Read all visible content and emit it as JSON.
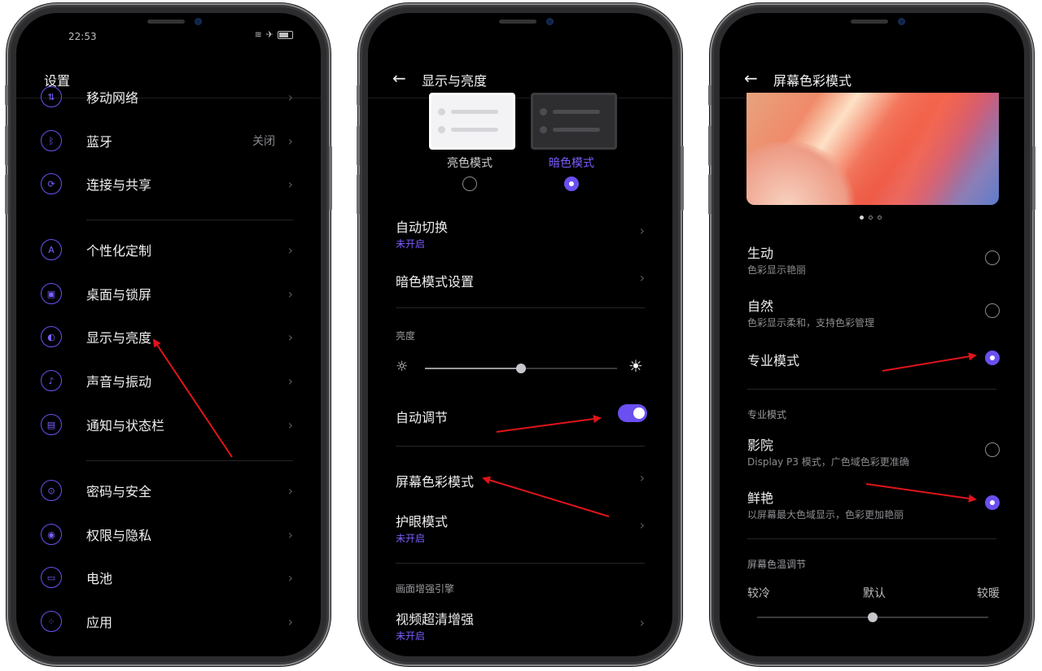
{
  "screen1": {
    "time": "22:53",
    "title": "设置",
    "items": [
      {
        "label": "移动网络",
        "icon": "mobile-network-icon",
        "glyph": "⇅"
      },
      {
        "label": "蓝牙",
        "icon": "bluetooth-icon",
        "glyph": "ᛒ",
        "value": "关闭"
      },
      {
        "label": "连接与共享",
        "icon": "share-icon",
        "glyph": "⟳"
      },
      {
        "label": "个性化定制",
        "icon": "personalize-icon",
        "glyph": "A"
      },
      {
        "label": "桌面与锁屏",
        "icon": "wallpaper-icon",
        "glyph": "▣"
      },
      {
        "label": "显示与亮度",
        "icon": "display-icon",
        "glyph": "◐"
      },
      {
        "label": "声音与振动",
        "icon": "sound-icon",
        "glyph": "♪"
      },
      {
        "label": "通知与状态栏",
        "icon": "notification-icon",
        "glyph": "▤"
      },
      {
        "label": "密码与安全",
        "icon": "lock-icon",
        "glyph": "⊙"
      },
      {
        "label": "权限与隐私",
        "icon": "privacy-icon",
        "glyph": "◉"
      },
      {
        "label": "电池",
        "icon": "battery-icon",
        "glyph": "▭"
      },
      {
        "label": "应用",
        "icon": "apps-icon",
        "glyph": "⁘"
      }
    ]
  },
  "screen2": {
    "title": "显示与亮度",
    "light_mode": "亮色模式",
    "dark_mode": "暗色模式",
    "auto_switch": "自动切换",
    "auto_switch_status": "未开启",
    "dark_settings": "暗色模式设置",
    "brightness_section": "亮度",
    "brightness_level": 0.5,
    "auto_adjust": "自动调节",
    "auto_adjust_on": true,
    "color_mode": "屏幕色彩模式",
    "eye_care": "护眼模式",
    "eye_care_status": "未开启",
    "enhance_section": "画面增强引擎",
    "video_enhance": "视频超清增强",
    "video_enhance_status": "未开启"
  },
  "screen3": {
    "title": "屏幕色彩模式",
    "modes": [
      {
        "name": "生动",
        "desc": "色彩显示艳丽",
        "selected": false
      },
      {
        "name": "自然",
        "desc": "色彩显示柔和，支持色彩管理",
        "selected": false
      },
      {
        "name": "专业模式",
        "desc": "",
        "selected": true
      }
    ],
    "pro_section": "专业模式",
    "pro_modes": [
      {
        "name": "影院",
        "desc": "Display P3 模式，广色域色彩更准确",
        "selected": false
      },
      {
        "name": "鲜艳",
        "desc": "以屏幕最大色域显示，色彩更加艳丽",
        "selected": true
      }
    ],
    "temp_section": "屏幕色温调节",
    "temp_cold": "较冷",
    "temp_default": "默认",
    "temp_warm": "较暖",
    "temp_level": 0.5
  },
  "colors": {
    "accent": "#6b4ff0",
    "arrow": "#e0141a"
  }
}
